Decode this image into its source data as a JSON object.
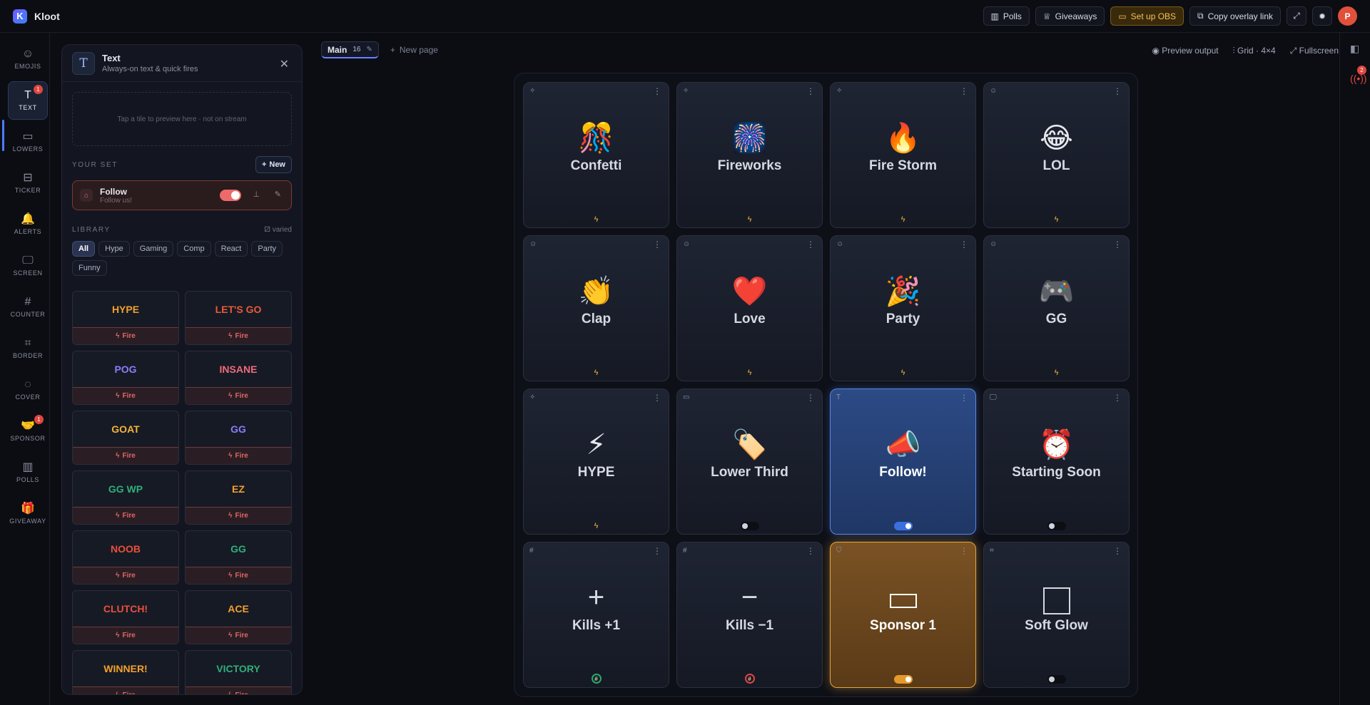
{
  "app": {
    "name": "Kloot",
    "logo_letter": "K"
  },
  "topbar": {
    "polls": "Polls",
    "giveaways": "Giveaways",
    "setup_obs": "Set up OBS",
    "copy_overlay": "Copy overlay link",
    "avatar": "P"
  },
  "rail": [
    {
      "label": "EMOJIS",
      "icon": "smile-icon",
      "glyph": "☺"
    },
    {
      "label": "TEXT",
      "icon": "text-icon",
      "glyph": "T",
      "badge": "1",
      "active": true
    },
    {
      "label": "LOWERS",
      "icon": "lower-third-icon",
      "glyph": "▭"
    },
    {
      "label": "TICKER",
      "icon": "ticker-icon",
      "glyph": "⊟"
    },
    {
      "label": "ALERTS",
      "icon": "bell-icon",
      "glyph": "🔔"
    },
    {
      "label": "SCREEN",
      "icon": "monitor-icon",
      "glyph": "🖵"
    },
    {
      "label": "COUNTER",
      "icon": "hash-icon",
      "glyph": "#"
    },
    {
      "label": "BORDER",
      "icon": "frame-icon",
      "glyph": "⌗"
    },
    {
      "label": "COVER",
      "icon": "eye-off-icon",
      "glyph": "◌"
    },
    {
      "label": "SPONSOR",
      "icon": "handshake-icon",
      "glyph": "🤝",
      "badge": "1"
    },
    {
      "label": "POLLS",
      "icon": "bar-chart-icon",
      "glyph": "▥"
    },
    {
      "label": "GIVEAWAY",
      "icon": "gift-icon",
      "glyph": "🎁"
    }
  ],
  "panel": {
    "title": "Text",
    "subtitle": "Always-on text & quick fires",
    "preview_hint": "Tap a tile to preview here · not on stream",
    "your_set_label": "YOUR SET",
    "new_label": "New",
    "set_item": {
      "title": "Follow",
      "subtitle": "Follow us!",
      "enabled": true
    },
    "library_label": "LIBRARY",
    "varied_label": "varied",
    "filters": [
      "All",
      "Hype",
      "Gaming",
      "Comp",
      "React",
      "Party",
      "Funny"
    ],
    "fire_label": "Fire",
    "library": [
      {
        "text": "HYPE",
        "color": "#f2a12c"
      },
      {
        "text": "LET'S GO",
        "color": "#e85a3a"
      },
      {
        "text": "POG",
        "color": "#8b7cf6"
      },
      {
        "text": "INSANE",
        "color": "#f06a7a"
      },
      {
        "text": "GOAT",
        "color": "#f2b63c"
      },
      {
        "text": "GG",
        "color": "#8b7cf6"
      },
      {
        "text": "GG WP",
        "color": "#2fae7a"
      },
      {
        "text": "EZ",
        "color": "#f2a12c"
      },
      {
        "text": "NOOB",
        "color": "#e8503a"
      },
      {
        "text": "GG",
        "color": "#2fae7a"
      },
      {
        "text": "CLUTCH!",
        "color": "#e8503a"
      },
      {
        "text": "ACE",
        "color": "#f2a12c"
      },
      {
        "text": "WINNER!",
        "color": "#f2a12c"
      },
      {
        "text": "VICTORY",
        "color": "#2fae7a"
      }
    ]
  },
  "tabs": {
    "main": "Main",
    "count": "16",
    "new_page": "New page"
  },
  "view": {
    "preview": "Preview output",
    "grid": "Grid · 4×4",
    "fullscreen": "Fullscreen"
  },
  "right_rail": {
    "badge": "2"
  },
  "tiles": [
    {
      "label": "Confetti",
      "emoji": "🎊",
      "type": "sparkle-icon",
      "footer": "bolt"
    },
    {
      "label": "Fireworks",
      "emoji": "🎆",
      "type": "sparkle-icon",
      "footer": "bolt"
    },
    {
      "label": "Fire Storm",
      "emoji": "🔥",
      "type": "sparkle-icon",
      "footer": "bolt"
    },
    {
      "label": "LOL",
      "emoji": "😂",
      "type": "smile-icon",
      "footer": "bolt"
    },
    {
      "label": "Clap",
      "emoji": "👏",
      "type": "smile-icon",
      "footer": "bolt"
    },
    {
      "label": "Love",
      "emoji": "❤️",
      "type": "smile-icon",
      "footer": "bolt"
    },
    {
      "label": "Party",
      "emoji": "🎉",
      "type": "smile-icon",
      "footer": "bolt"
    },
    {
      "label": "GG",
      "emoji": "🎮",
      "type": "smile-icon",
      "footer": "bolt"
    },
    {
      "label": "HYPE",
      "emoji": "⚡",
      "type": "sparkle-icon",
      "footer": "bolt"
    },
    {
      "label": "Lower Third",
      "emoji": "🏷️",
      "type": "lower-third-icon",
      "footer": "switch-off"
    },
    {
      "label": "Follow!",
      "emoji": "📣",
      "type": "text-icon",
      "footer": "switch-on",
      "style": "blue"
    },
    {
      "label": "Starting Soon",
      "emoji": "⏰",
      "type": "monitor-icon",
      "footer": "switch-off"
    },
    {
      "label": "Kills +1",
      "glyph": "+",
      "type": "hash-icon",
      "footer": "counter-green"
    },
    {
      "label": "Kills −1",
      "glyph": "−",
      "type": "hash-icon",
      "footer": "counter-red"
    },
    {
      "label": "Sponsor 1",
      "shape": "rect",
      "type": "handshake-icon",
      "footer": "switch-gold",
      "style": "gold"
    },
    {
      "label": "Soft Glow",
      "shape": "square",
      "type": "frame-icon",
      "footer": "switch-off"
    }
  ]
}
